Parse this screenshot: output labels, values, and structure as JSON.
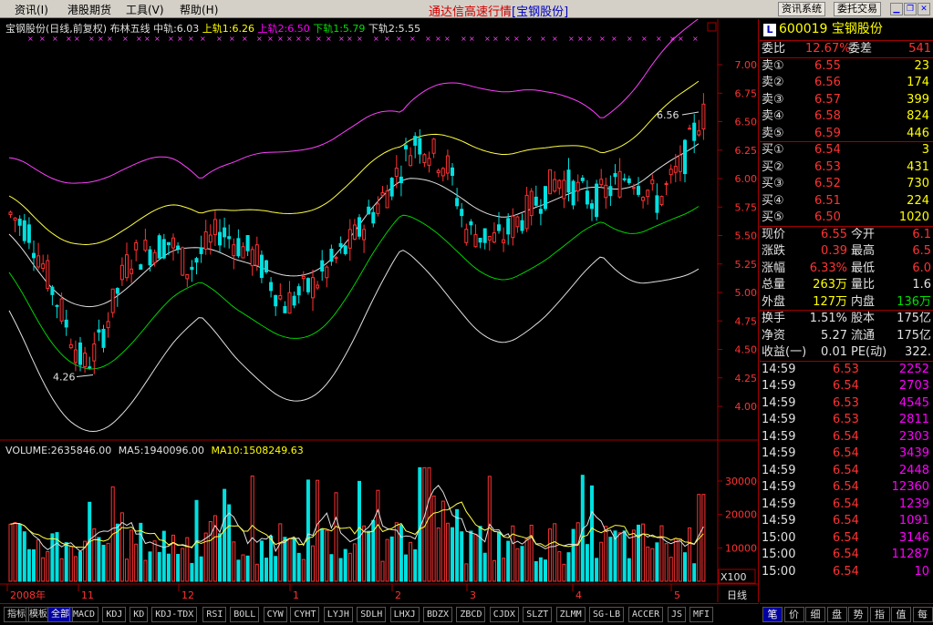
{
  "menu": {
    "items": [
      "资讯(I)",
      "港股期货",
      "工具(V)",
      "帮助(H)"
    ],
    "title": "通达信高速行情",
    "title_stock": "[宝钢股份]",
    "buttons": [
      "资讯系统",
      "委托交易"
    ]
  },
  "chart_header": {
    "stock": "宝钢股份(日线,前复权)",
    "indicator": "布林五线",
    "mid": "中轨:6.03",
    "up1": "上轨1:6.26",
    "up2": "上轨2:6.50",
    "down1": "下轨1:5.79",
    "down2": "下轨2:5.55"
  },
  "volume_header": {
    "volume": "VOLUME:2635846.00",
    "ma5": "MA5:1940096.00",
    "ma10": "MA10:1508249.63"
  },
  "price_axis": [
    "7.00",
    "6.75",
    "6.50",
    "6.25",
    "6.00",
    "5.75",
    "5.50",
    "5.25",
    "5.00",
    "4.75",
    "4.50",
    "4.25",
    "4.00"
  ],
  "vol_axis": [
    "30000",
    "20000",
    "10000"
  ],
  "vol_unit": "X100",
  "date_axis": [
    "2008年",
    "11",
    "12",
    "1",
    "2",
    "3",
    "4",
    "5"
  ],
  "period_label": "日线",
  "annotations": {
    "high": "6.56",
    "low": "4.26"
  },
  "colors": {
    "up": "#ff3232",
    "down": "#00e0e0",
    "mid": "#ffff40",
    "band1": "#e0e0e0",
    "band2": "#ff40ff",
    "green": "#00d000"
  },
  "panel": {
    "code": "600019",
    "name": "宝钢股份",
    "badge": "L",
    "weibi_label": "委比",
    "weibi": "12.67%",
    "weicha_label": "委差",
    "weicha": "541",
    "asks": [
      {
        "label": "卖⑤",
        "price": "6.59",
        "vol": "446"
      },
      {
        "label": "卖④",
        "price": "6.58",
        "vol": "824"
      },
      {
        "label": "卖③",
        "price": "6.57",
        "vol": "399"
      },
      {
        "label": "卖②",
        "price": "6.56",
        "vol": "174"
      },
      {
        "label": "卖①",
        "price": "6.55",
        "vol": "23"
      }
    ],
    "bids": [
      {
        "label": "买①",
        "price": "6.54",
        "vol": "3"
      },
      {
        "label": "买②",
        "price": "6.53",
        "vol": "431"
      },
      {
        "label": "买③",
        "price": "6.52",
        "vol": "730"
      },
      {
        "label": "买④",
        "price": "6.51",
        "vol": "224"
      },
      {
        "label": "买⑤",
        "price": "6.50",
        "vol": "1020"
      }
    ],
    "stats": [
      {
        "l1": "现价",
        "v1": "6.55",
        "l2": "今开",
        "v2": "6.1"
      },
      {
        "l1": "涨跌",
        "v1": "0.39",
        "l2": "最高",
        "v2": "6.5"
      },
      {
        "l1": "涨幅",
        "v1": "6.33%",
        "l2": "最低",
        "v2": "6.0"
      },
      {
        "l1": "总量",
        "v1": "263万",
        "l2": "量比",
        "v2": "1.6"
      },
      {
        "l1": "外盘",
        "v1": "127万",
        "l2": "内盘",
        "v2": "136万"
      }
    ],
    "info": [
      {
        "l1": "换手",
        "v1": "1.51%",
        "l2": "股本",
        "v2": "175亿"
      },
      {
        "l1": "净资",
        "v1": "5.27",
        "l2": "流通",
        "v2": "175亿"
      },
      {
        "l1": "收益(一)",
        "v1": "0.01",
        "l2": "PE(动)",
        "v2": "322."
      }
    ],
    "ticks": [
      {
        "t": "14:59",
        "p": "6.53",
        "v": "2252"
      },
      {
        "t": "14:59",
        "p": "6.54",
        "v": "2703"
      },
      {
        "t": "14:59",
        "p": "6.53",
        "v": "4545"
      },
      {
        "t": "14:59",
        "p": "6.53",
        "v": "2811"
      },
      {
        "t": "14:59",
        "p": "6.54",
        "v": "2303"
      },
      {
        "t": "14:59",
        "p": "6.54",
        "v": "3439"
      },
      {
        "t": "14:59",
        "p": "6.54",
        "v": "2448"
      },
      {
        "t": "14:59",
        "p": "6.54",
        "v": "12360"
      },
      {
        "t": "14:59",
        "p": "6.54",
        "v": "1239"
      },
      {
        "t": "14:59",
        "p": "6.54",
        "v": "1091"
      },
      {
        "t": "15:00",
        "p": "6.54",
        "v": "3146"
      },
      {
        "t": "15:00",
        "p": "6.54",
        "v": "11287"
      },
      {
        "t": "15:00",
        "p": "6.54",
        "v": "10"
      }
    ]
  },
  "tabs": [
    "指标",
    "模板",
    "全部",
    "MACD",
    "KDJ",
    "KD",
    "KDJ-TDX",
    "RSI",
    "BOLL",
    "CYW",
    "CYHT",
    "LYJH",
    "SDLH",
    "LHXJ",
    "BDZX",
    "ZBCD",
    "CJDX",
    "SLZT",
    "ZLMM",
    "SG-LB",
    "ACCER",
    "JS",
    "MFI"
  ],
  "right_tabs": [
    "笔",
    "价",
    "细",
    "盘",
    "势",
    "指",
    "值",
    "每"
  ]
}
